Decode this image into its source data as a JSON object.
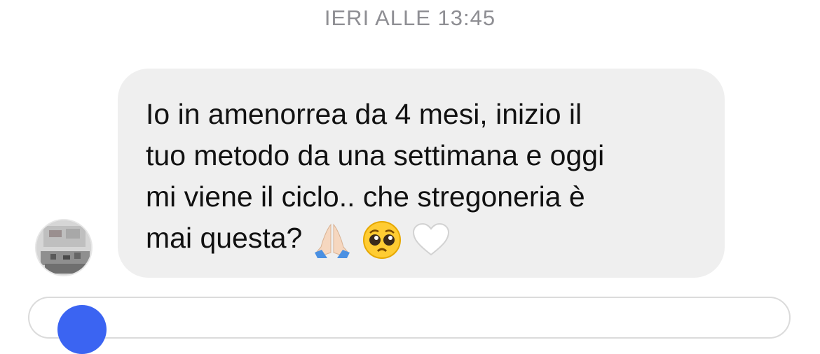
{
  "timestamp": "IERI ALLE 13:45",
  "message": {
    "lines": [
      "Io in amenorrea da 4 mesi, inizio il",
      "tuo metodo da una settimana e oggi",
      "mi viene il ciclo.. che stregoneria è",
      "mai questa?"
    ],
    "emojis": [
      "praying-hands-icon",
      "pleading-face-icon",
      "white-heart-icon"
    ]
  },
  "colors": {
    "bubble": "#efefef",
    "timestamp": "#8e8e93",
    "accent": "#3b64f2"
  }
}
